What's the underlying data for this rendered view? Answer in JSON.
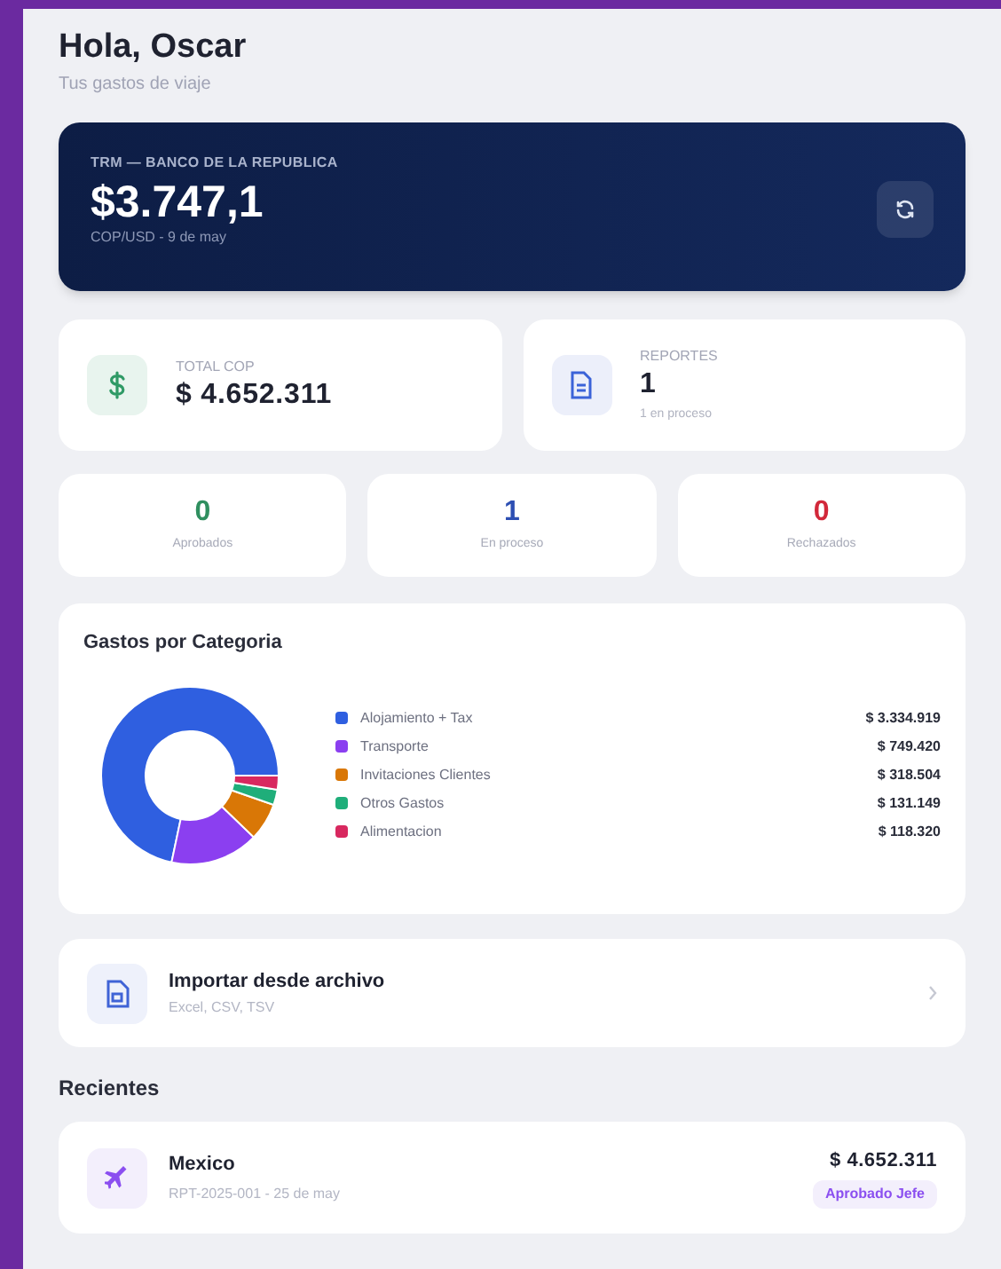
{
  "header": {
    "title": "Hola, Oscar",
    "subtitle": "Tus gastos de viaje"
  },
  "rate_card": {
    "label": "TRM — BANCO DE LA REPUBLICA",
    "value": "$3.747,1",
    "caption": "COP/USD - 9 de may"
  },
  "summary": [
    {
      "kind": "money",
      "label": "TOTAL COP",
      "value": "$ 4.652.311"
    },
    {
      "kind": "report",
      "label": "REPORTES",
      "value": "1",
      "caption": "1 en proceso"
    }
  ],
  "status_counts": [
    {
      "value": "0",
      "label": "Aprobados",
      "color": "#2f8f5f"
    },
    {
      "value": "1",
      "label": "En proceso",
      "color": "#2d4fb3"
    },
    {
      "value": "0",
      "label": "Rechazados",
      "color": "#d2283a"
    }
  ],
  "category_card": {
    "title": "Gastos por Categoria",
    "chart_data": {
      "type": "donut",
      "categories": [
        "Alojamiento + Tax",
        "Transporte",
        "Invitaciones Clientes",
        "Otros Gastos",
        "Alimentacion"
      ],
      "series": [
        {
          "values": [
            71.68,
            16.11,
            6.85,
            2.82,
            2.54
          ]
        }
      ],
      "value_labels": [
        "$ 3.334.919",
        "$ 749.420",
        "$ 318.504",
        "$ 131.149",
        "$ 118.320"
      ]
    },
    "legend": [
      {
        "color": "#2f5fe0"
      },
      {
        "color": "#8b3ff0"
      },
      {
        "color": "#d97706"
      },
      {
        "color": "#1fae7a"
      },
      {
        "color": "#d8285f"
      }
    ]
  },
  "import_card": {
    "title": "Importar desde archivo",
    "subtitle": "Excel, CSV, TSV"
  },
  "recent": {
    "title": "Recientes",
    "items": [
      {
        "name": "Mexico",
        "meta": "RPT-2025-001 - 25 de may",
        "amount": "$ 4.652.311",
        "status": "Aprobado Jefe"
      }
    ]
  }
}
